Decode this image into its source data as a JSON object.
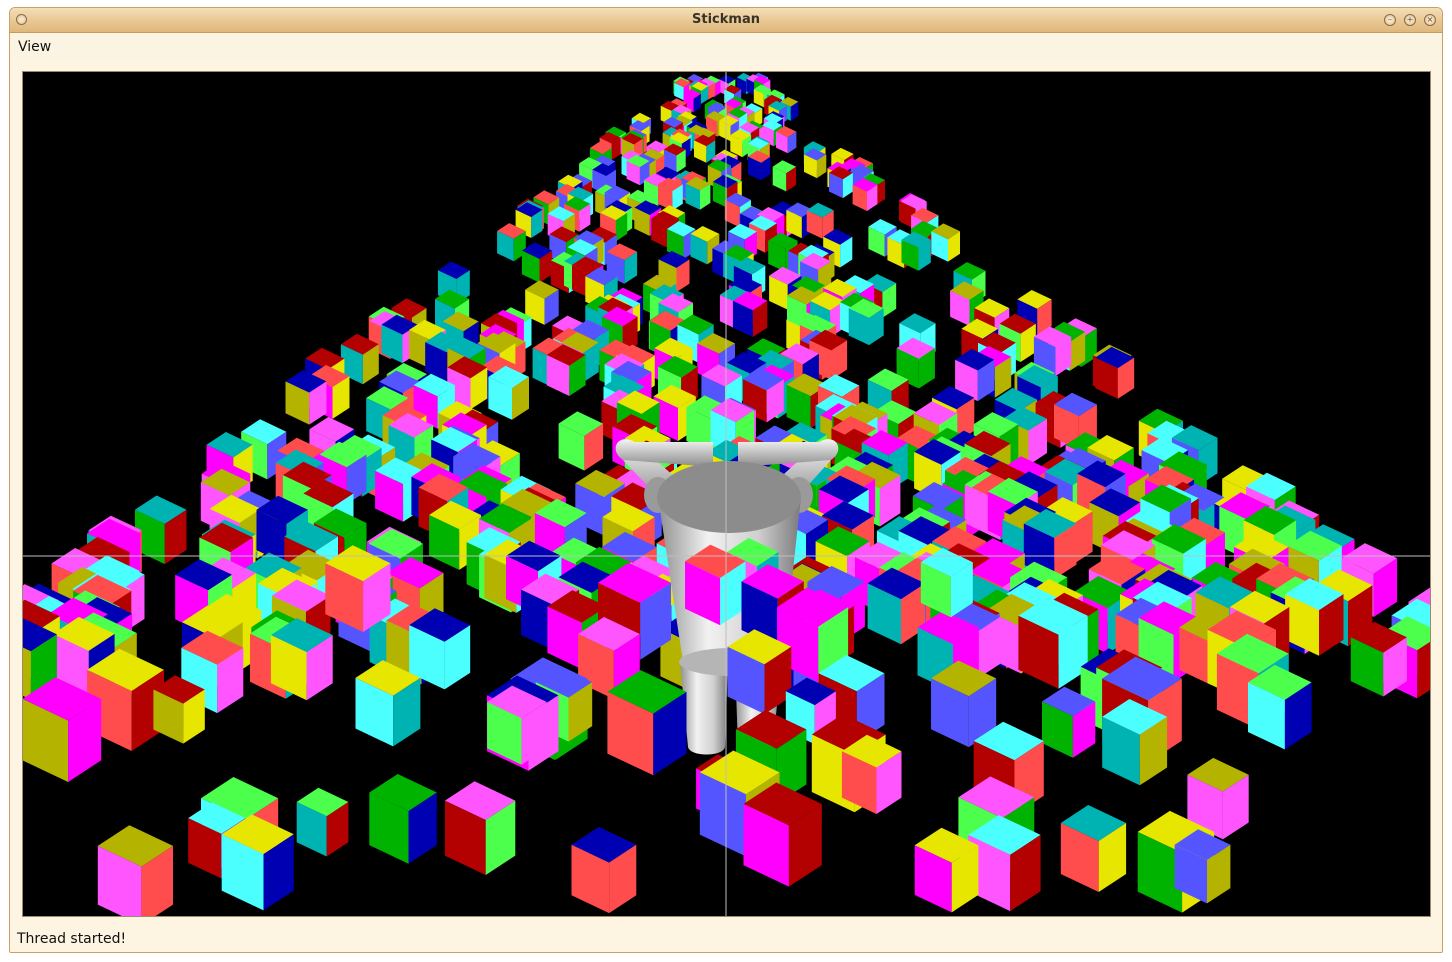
{
  "window": {
    "title": "Stickman"
  },
  "menu": {
    "items": [
      {
        "label": "View"
      }
    ]
  },
  "status": {
    "text": "Thread started!"
  },
  "colors": {
    "face_palette": [
      "#ff55ff",
      "#4cff4c",
      "#5555ff",
      "#ff4c4c",
      "#4cffff",
      "#b3b300",
      "#ff00ff",
      "#00b300",
      "#0000b3",
      "#b30000",
      "#00b3b3",
      "#e6e600"
    ],
    "figure": "#c9c9c9",
    "crosshair": "#bfbfbf",
    "background": "#000000"
  }
}
